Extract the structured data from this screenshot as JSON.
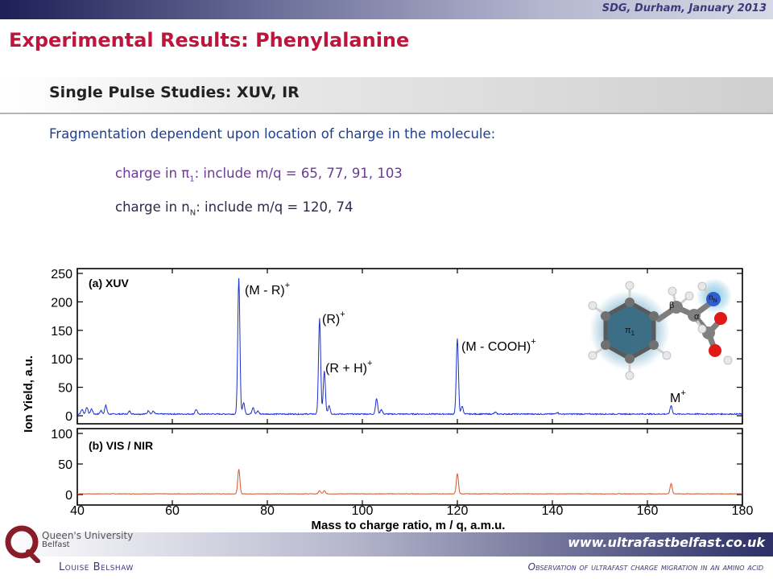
{
  "header": {
    "conference": "SDG, Durham, January 2013",
    "title": "Experimental Results: Phenylalanine"
  },
  "subtitle": "Single Pulse Studies: XUV, IR",
  "intro": "Fragmentation dependent upon location of charge in the molecule:",
  "bullets": [
    {
      "prefix": "charge in π",
      "sub": "1",
      "suffix": ": include m/q = 65, 77, 91, 103"
    },
    {
      "prefix": "charge in n",
      "sub": "N",
      "suffix": ": include m/q = 120, 74"
    }
  ],
  "footer": {
    "url": "www.ultrafastbelfast.co.uk",
    "author": "Louise Belshaw",
    "title": "Observation of ultrafast charge migration in an amino acid",
    "logo_line1": "Queen's University",
    "logo_line2": "Belfast"
  },
  "colors": {
    "title": "#c0143c",
    "xuv_trace": "#1a2fd0",
    "vis_trace": "#d9542a",
    "molecule_ring": "#3c6f86",
    "glow": "#5c9fc0"
  },
  "molecule_labels": {
    "pi": "π",
    "pi_sub": "1",
    "beta": "β",
    "alpha": "α",
    "n": "n",
    "n_sub": "N"
  },
  "chart_data": [
    {
      "type": "line",
      "panel_label": "(a) XUV",
      "xlabel": "Mass to charge ratio, m / q, a.m.u.",
      "ylabel": "Ion Yield, a.u.",
      "xlim": [
        40,
        180
      ],
      "ylim": [
        0,
        250
      ],
      "xticks": [
        40,
        60,
        80,
        100,
        120,
        140,
        160,
        180
      ],
      "yticks": [
        0,
        50,
        100,
        150,
        200,
        250
      ],
      "grid": false,
      "peaks": [
        {
          "x": 41,
          "y": 8
        },
        {
          "x": 42,
          "y": 12
        },
        {
          "x": 43,
          "y": 9
        },
        {
          "x": 45,
          "y": 6
        },
        {
          "x": 46,
          "y": 15
        },
        {
          "x": 51,
          "y": 5
        },
        {
          "x": 55,
          "y": 6
        },
        {
          "x": 56,
          "y": 5
        },
        {
          "x": 65,
          "y": 8
        },
        {
          "x": 74,
          "y": 238
        },
        {
          "x": 75,
          "y": 20
        },
        {
          "x": 77,
          "y": 12
        },
        {
          "x": 78,
          "y": 5
        },
        {
          "x": 91,
          "y": 168
        },
        {
          "x": 92,
          "y": 75
        },
        {
          "x": 93,
          "y": 15
        },
        {
          "x": 103,
          "y": 27
        },
        {
          "x": 104,
          "y": 8
        },
        {
          "x": 120,
          "y": 132
        },
        {
          "x": 121,
          "y": 14
        },
        {
          "x": 128,
          "y": 3
        },
        {
          "x": 141,
          "y": 3
        },
        {
          "x": 165,
          "y": 15
        }
      ],
      "annotations": [
        {
          "text": "(M - R)",
          "sup": "+",
          "at_x": 74
        },
        {
          "text": "(R)",
          "sup": "+",
          "at_x": 91
        },
        {
          "text": "(R + H)",
          "sup": "+",
          "at_x": 92
        },
        {
          "text": "(M - COOH)",
          "sup": "+",
          "at_x": 120
        },
        {
          "text": "M",
          "sup": "+",
          "at_x": 165
        }
      ]
    },
    {
      "type": "line",
      "panel_label": "(b) VIS / NIR",
      "xlabel": "Mass to charge ratio, m / q, a.m.u.",
      "xlim": [
        40,
        180
      ],
      "ylim": [
        0,
        100
      ],
      "xticks": [
        40,
        60,
        80,
        100,
        120,
        140,
        160,
        180
      ],
      "yticks": [
        0,
        50,
        100
      ],
      "grid": false,
      "peaks": [
        {
          "x": 74,
          "y": 40
        },
        {
          "x": 91,
          "y": 5
        },
        {
          "x": 92,
          "y": 5
        },
        {
          "x": 120,
          "y": 33
        },
        {
          "x": 165,
          "y": 17
        }
      ]
    }
  ]
}
